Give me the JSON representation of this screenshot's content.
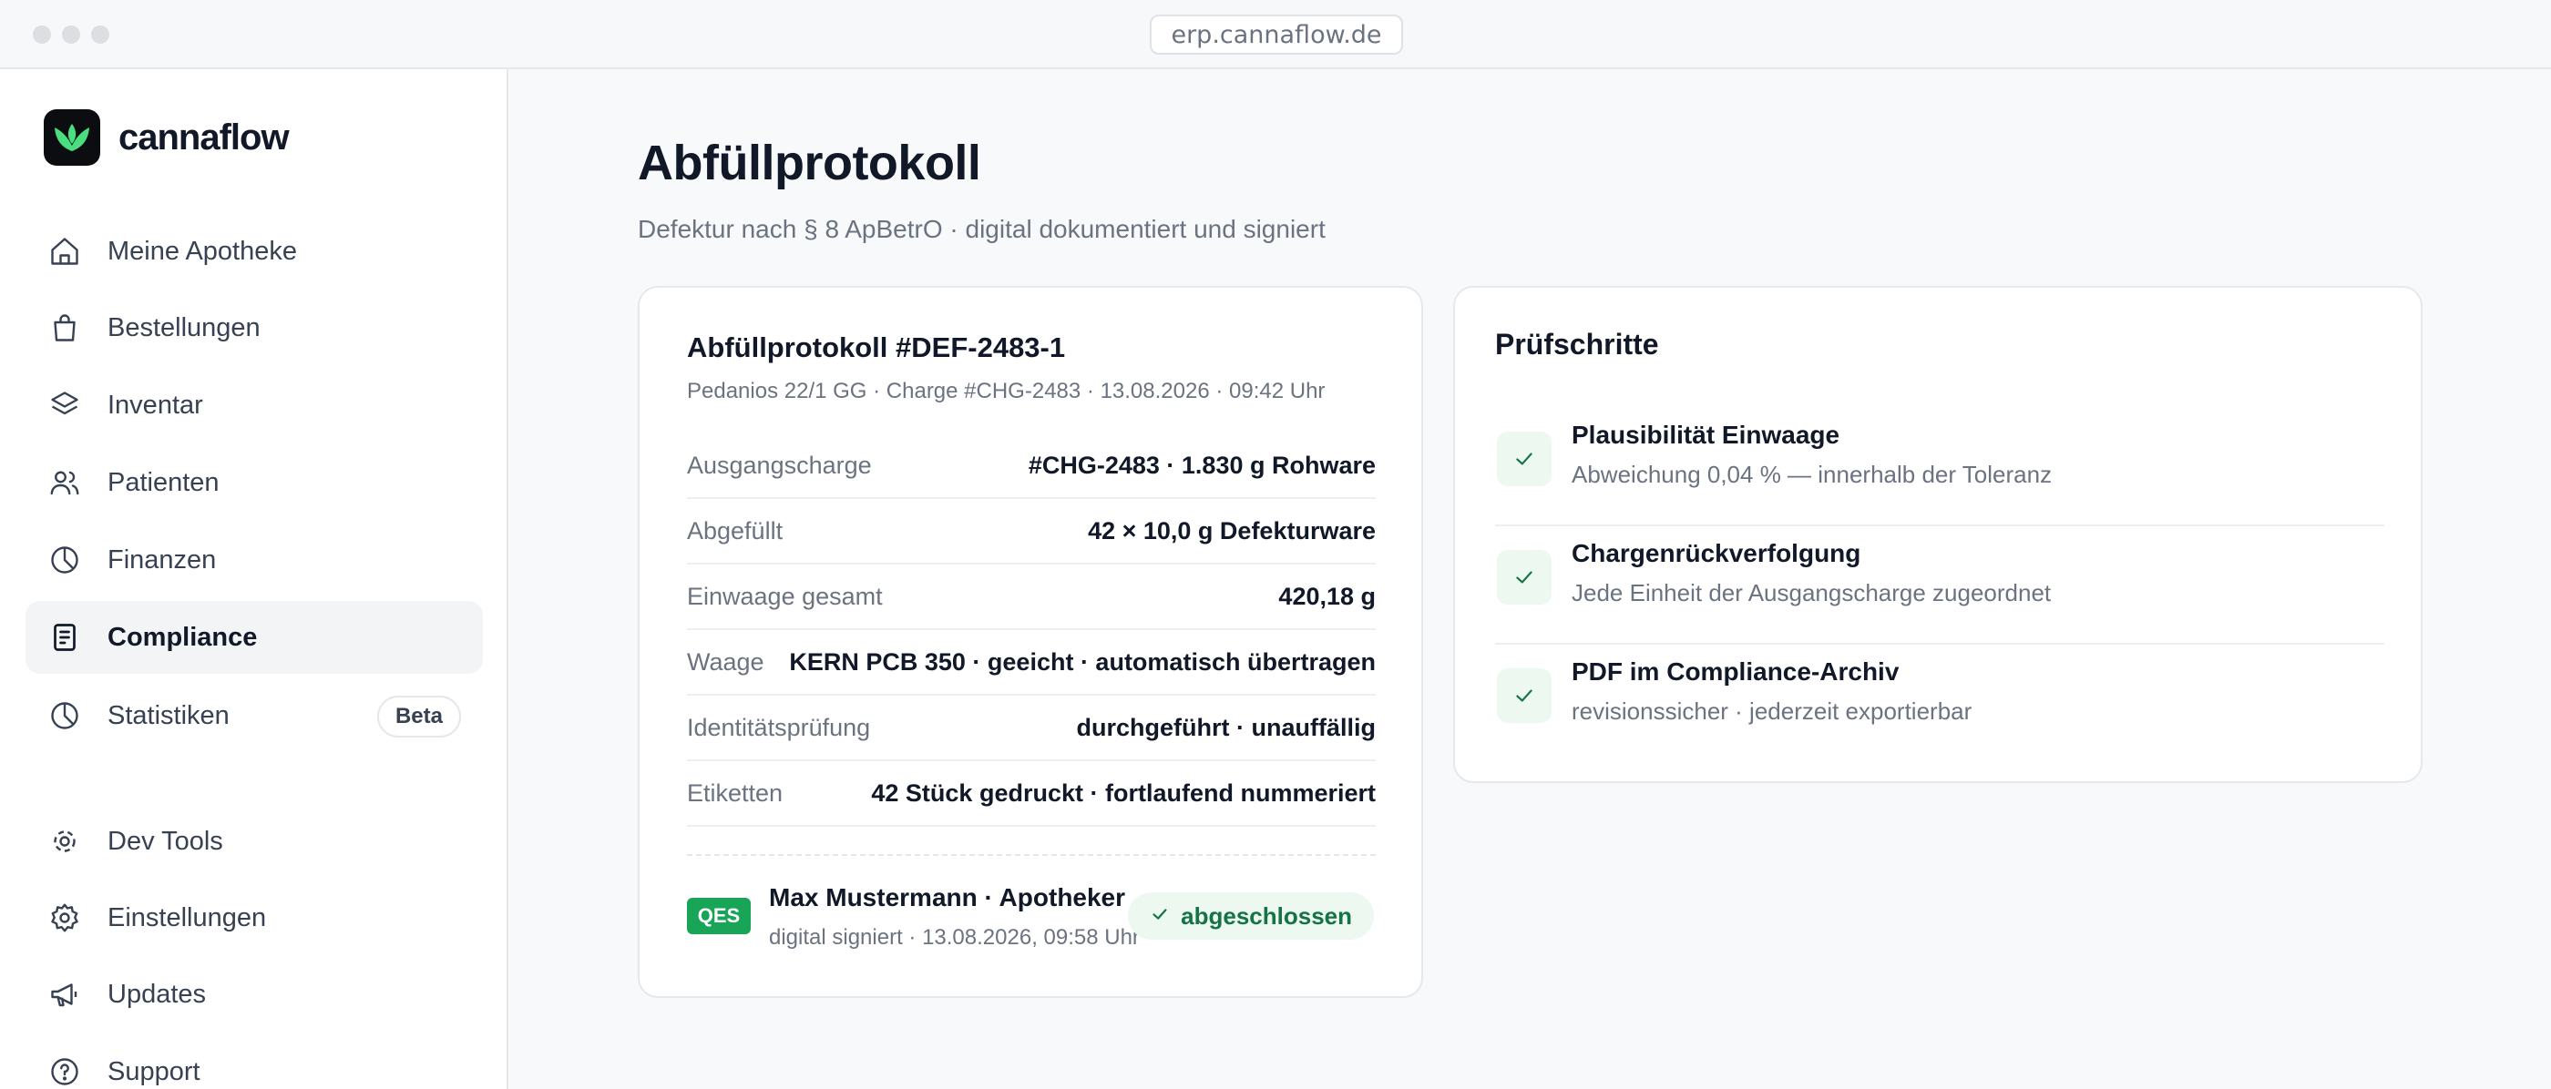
{
  "browser": {
    "url": "erp.cannaflow.de"
  },
  "brand": {
    "name": "cannaflow"
  },
  "sidebar": {
    "items": [
      {
        "label": "Meine Apotheke",
        "icon": "home-icon"
      },
      {
        "label": "Bestellungen",
        "icon": "shopping-bag-icon"
      },
      {
        "label": "Inventar",
        "icon": "layers-icon"
      },
      {
        "label": "Patienten",
        "icon": "users-icon"
      },
      {
        "label": "Finanzen",
        "icon": "pie-chart-icon"
      },
      {
        "label": "Compliance",
        "icon": "document-icon",
        "active": true
      },
      {
        "label": "Statistiken",
        "icon": "pie-chart-icon",
        "badge": "Beta"
      },
      {
        "label": "Dev Tools",
        "icon": "dev-tools-icon"
      },
      {
        "label": "Einstellungen",
        "icon": "gear-icon"
      },
      {
        "label": "Updates",
        "icon": "megaphone-icon"
      },
      {
        "label": "Support",
        "icon": "help-circle-icon"
      }
    ]
  },
  "page": {
    "title": "Abfüllprotokoll",
    "subtitle": "Defektur nach § 8 ApBetrO · digital dokumentiert und signiert"
  },
  "protocol": {
    "title": "Abfüllprotokoll #DEF-2483-1",
    "meta": "Pedanios 22/1 GG · Charge #CHG-2483 · 13.08.2026 · 09:42 Uhr",
    "rows": [
      {
        "label": "Ausgangscharge",
        "value": "#CHG-2483 · 1.830 g Rohware"
      },
      {
        "label": "Abgefüllt",
        "value": "42 × 10,0 g Defekturware"
      },
      {
        "label": "Einwaage gesamt",
        "value": "420,18 g"
      },
      {
        "label": "Waage",
        "value": "KERN PCB 350 · geeicht · automatisch übertragen"
      },
      {
        "label": "Identitätsprüfung",
        "value": "durchgeführt · unauffällig"
      },
      {
        "label": "Etiketten",
        "value": "42 Stück gedruckt · fortlaufend nummeriert"
      }
    ],
    "signature": {
      "badge": "QES",
      "signer": "Max Mustermann · Apotheker",
      "signed_at": "digital signiert · 13.08.2026, 09:58 Uhr",
      "status": "abgeschlossen"
    }
  },
  "checks": {
    "title": "Prüfschritte",
    "items": [
      {
        "title": "Plausibilität Einwaage",
        "description": "Abweichung 0,04 % — innerhalb der Toleranz"
      },
      {
        "title": "Chargenrückverfolgung",
        "description": "Jede Einheit der Ausgangscharge zugeordnet"
      },
      {
        "title": "PDF im Compliance-Archiv",
        "description": "revisionssicher · jederzeit exportierbar"
      }
    ]
  },
  "colors": {
    "accent_green": "#18a558",
    "logo_green": "#4ade80",
    "status_green_text": "#157347",
    "status_green_bg": "#edf8f1"
  }
}
